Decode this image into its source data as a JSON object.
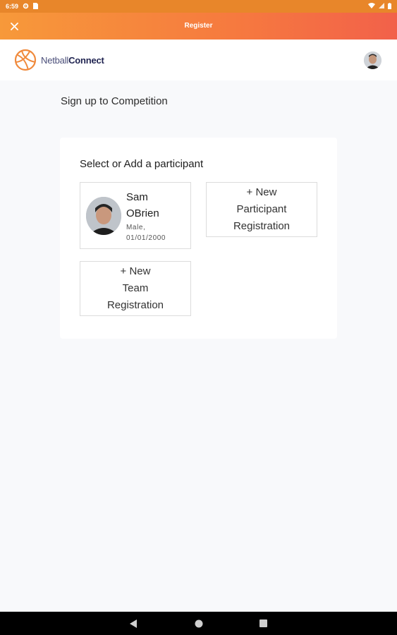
{
  "status_bar": {
    "time": "6:59"
  },
  "app_bar": {
    "title": "Register"
  },
  "header": {
    "logo_light": "Netball",
    "logo_bold": "Connect"
  },
  "page": {
    "heading": "Sign up to Competition"
  },
  "card": {
    "title": "Select or Add a participant",
    "participant": {
      "name_first": "Sam",
      "name_last": "OBrien",
      "gender": "Male,",
      "dob": "01/01/2000"
    },
    "new_participant": {
      "line1": "+ New",
      "line2": "Participant",
      "line3": "Registration"
    },
    "new_team": {
      "line1": "+ New",
      "line2": "Team",
      "line3": "Registration"
    }
  },
  "icons": [
    "close-icon",
    "netball-logo-icon",
    "wifi-icon",
    "signal-icon",
    "battery-icon",
    "back-icon",
    "home-icon",
    "recents-icon"
  ],
  "colors": {
    "accent_start": "#f7993a",
    "accent_end": "#f2614a",
    "brand_navy": "#1f2350"
  }
}
